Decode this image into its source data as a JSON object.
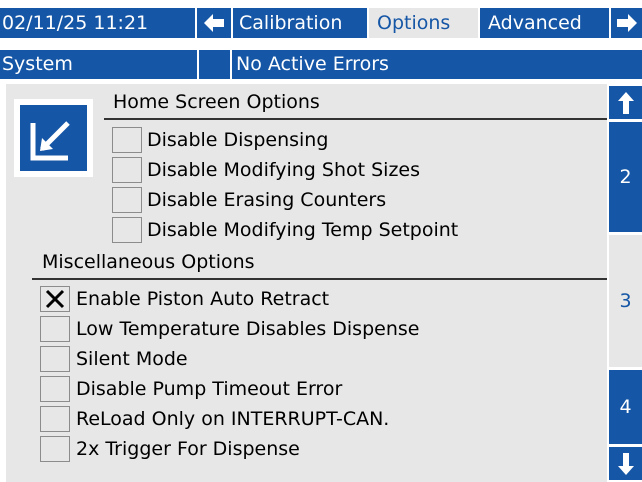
{
  "header": {
    "datetime": "02/11/25 11:21",
    "tabs": [
      {
        "label": "Calibration",
        "active": false
      },
      {
        "label": "Options",
        "active": true
      },
      {
        "label": "Advanced",
        "active": false
      }
    ],
    "prev_icon": "left-arrow-icon",
    "next_icon": "right-arrow-icon"
  },
  "status": {
    "mode": "System",
    "indicator": "",
    "message": "No Active Errors"
  },
  "home_screen": {
    "title": "Home Screen Options",
    "icon": "edit-screen-icon",
    "options": [
      {
        "label": "Disable Dispensing",
        "checked": false
      },
      {
        "label": "Disable Modifying Shot Sizes",
        "checked": false
      },
      {
        "label": "Disable Erasing Counters",
        "checked": false
      },
      {
        "label": "Disable Modifying Temp Setpoint",
        "checked": false
      }
    ]
  },
  "misc": {
    "title": "Miscellaneous Options",
    "options": [
      {
        "label": "Enable Piston Auto Retract",
        "checked": true
      },
      {
        "label": "Low Temperature Disables Dispense",
        "checked": false
      },
      {
        "label": "Silent Mode",
        "checked": false
      },
      {
        "label": "Disable Pump Timeout Error",
        "checked": false
      },
      {
        "label": "ReLoad Only on INTERRUPT-CAN.",
        "checked": false
      },
      {
        "label": "2x Trigger For Dispense",
        "checked": false
      }
    ]
  },
  "pager": {
    "pages": [
      "2",
      "3",
      "4"
    ],
    "active_page": "3",
    "up_icon": "up-arrow-icon",
    "down_icon": "down-arrow-icon"
  },
  "colors": {
    "accent": "#1556a6",
    "panel": "#e7e7e7"
  }
}
